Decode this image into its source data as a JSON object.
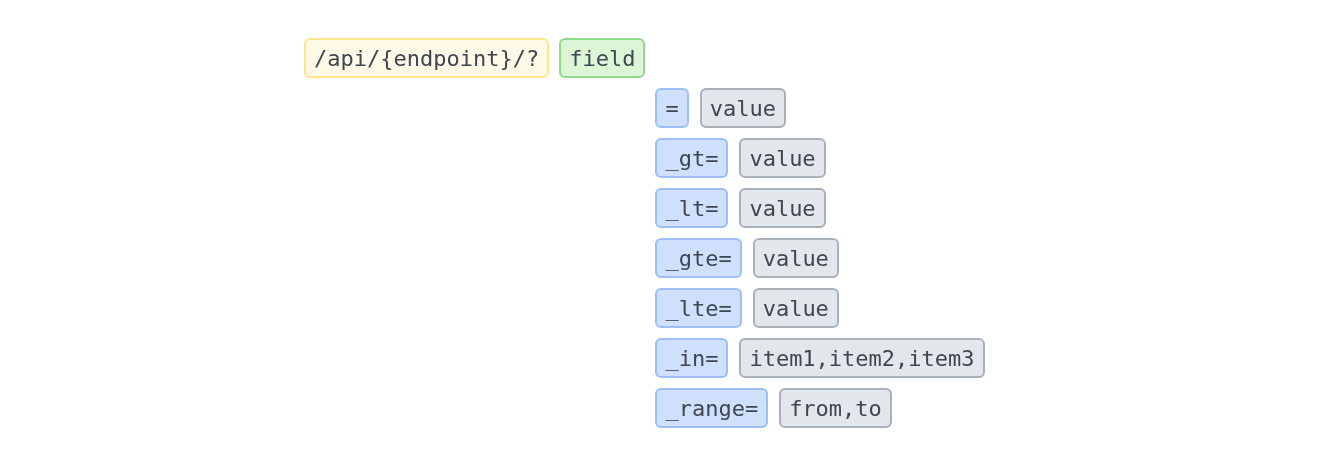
{
  "path": "/api/{endpoint}/?",
  "field": "field",
  "operators": [
    {
      "operator": "=",
      "value": "value"
    },
    {
      "operator": "_gt=",
      "value": "value"
    },
    {
      "operator": "_lt=",
      "value": "value"
    },
    {
      "operator": "_gte=",
      "value": "value"
    },
    {
      "operator": "_lte=",
      "value": "value"
    },
    {
      "operator": "_in=",
      "value": "item1,item2,item3"
    },
    {
      "operator": "_range=",
      "value": "from,to"
    }
  ]
}
